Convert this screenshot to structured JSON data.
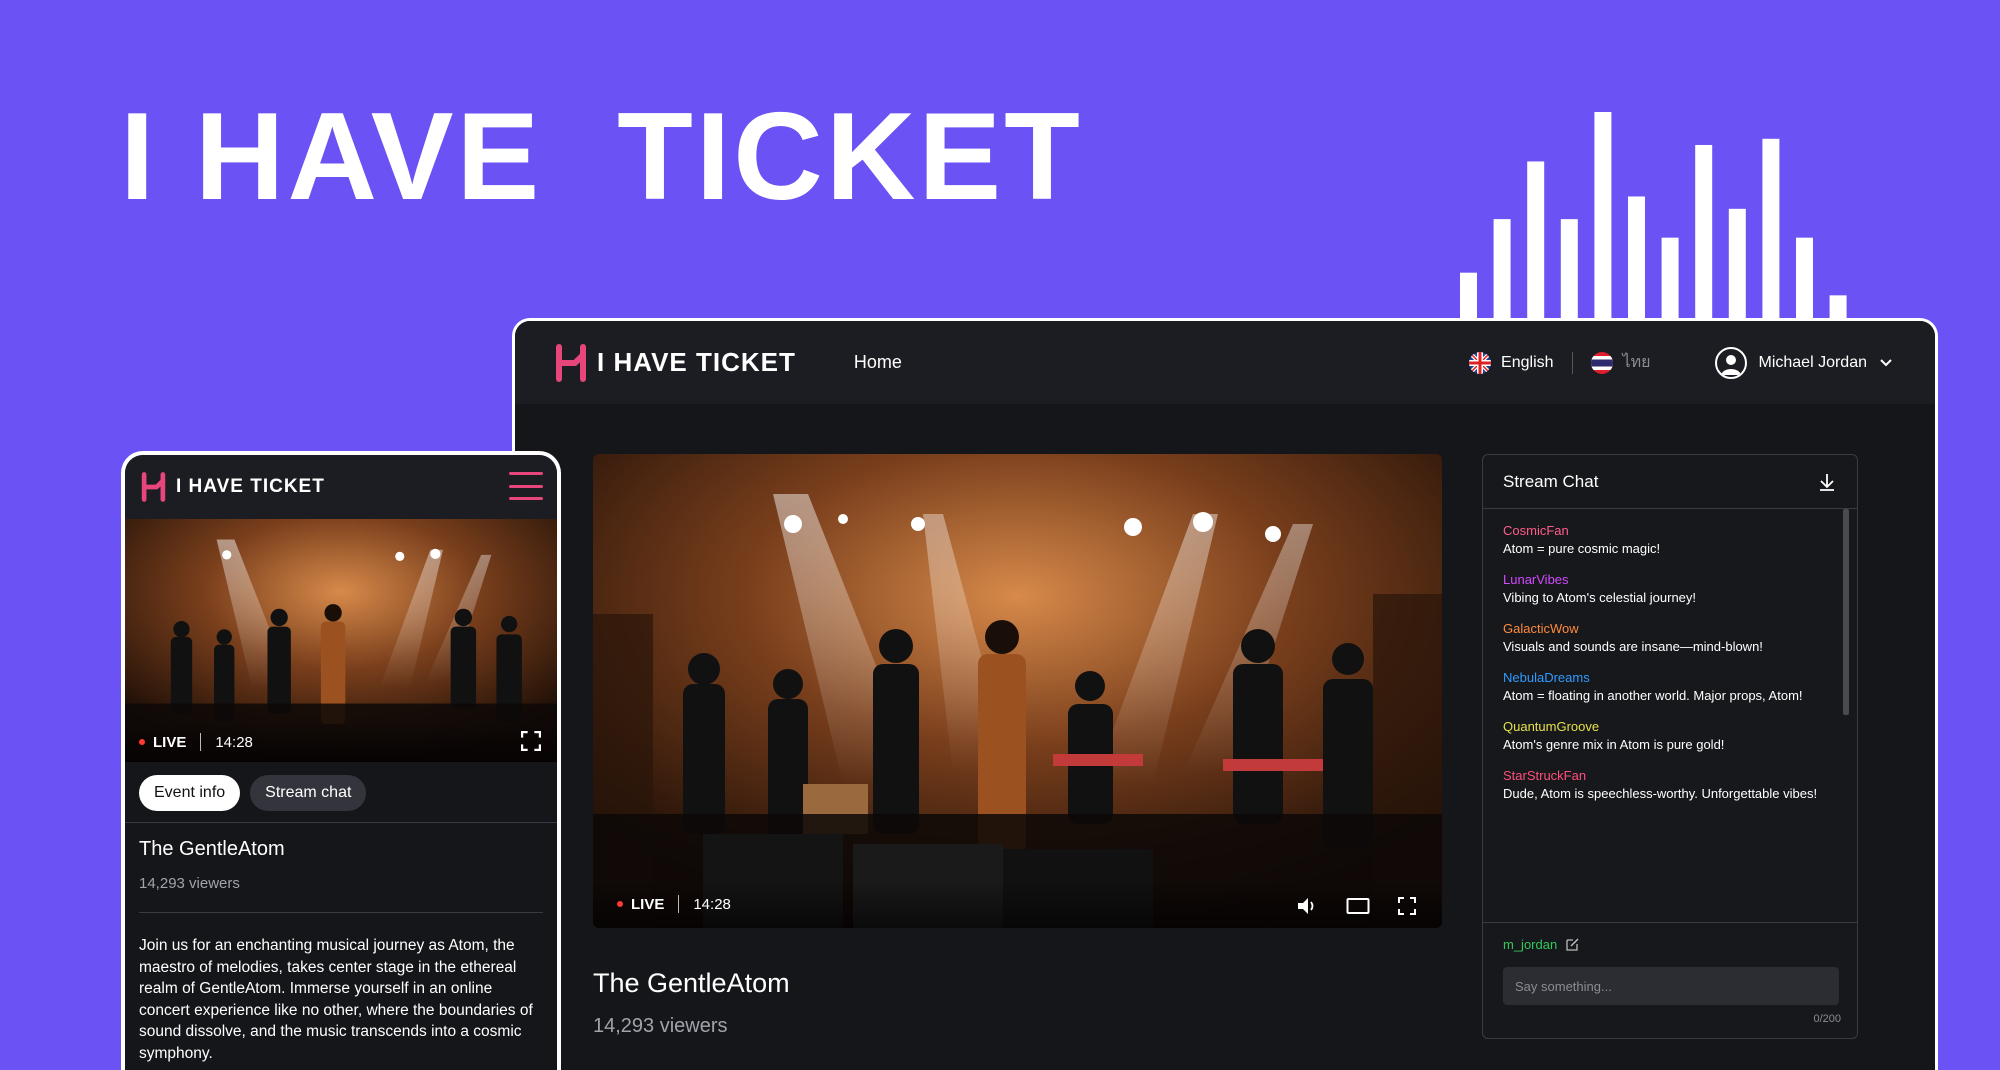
{
  "hero": {
    "title": "I HAVE  TICKET"
  },
  "equalizer": {
    "levels": [
      0.22,
      0.48,
      0.76,
      0.48,
      1.0,
      0.59,
      0.39,
      0.84,
      0.53,
      0.87,
      0.39,
      0.11
    ]
  },
  "brand": {
    "name": "I HAVE TICKET",
    "accent": "#e8457a"
  },
  "desktop": {
    "nav": {
      "home": "Home",
      "lang_en": "English",
      "lang_th": "ไทย",
      "user_name": "Michael Jordan"
    },
    "player": {
      "live": "LIVE",
      "time": "14:28"
    },
    "event": {
      "title": "The GentleAtom",
      "viewers": "14,293 viewers"
    },
    "chat": {
      "title": "Stream Chat",
      "messages": [
        {
          "user": "CosmicFan",
          "color": "#ff5c8a",
          "text": "Atom = pure cosmic magic!"
        },
        {
          "user": "LunarVibes",
          "color": "#d24bff",
          "text": "Vibing to Atom's celestial journey!"
        },
        {
          "user": "GalacticWow",
          "color": "#ff8a3d",
          "text": "Visuals and sounds are insane—mind-blown!"
        },
        {
          "user": "NebulaDreams",
          "color": "#2f9bff",
          "text": "Atom = floating in another world. Major props, Atom!"
        },
        {
          "user": "QuantumGroove",
          "color": "#e7e04b",
          "text": "Atom's genre mix in Atom is pure gold!"
        },
        {
          "user": "StarStruckFan",
          "color": "#ff4f7b",
          "text": "Dude, Atom is speechless-worthy. Unforgettable vibes!"
        }
      ],
      "username": "m_jordan",
      "placeholder": "Say something...",
      "counter": "0/200"
    }
  },
  "mobile": {
    "player": {
      "live": "LIVE",
      "time": "14:28"
    },
    "tabs": {
      "event_info": "Event info",
      "stream_chat": "Stream chat"
    },
    "event": {
      "title": "The GentleAtom",
      "viewers": "14,293 viewers",
      "description": "Join us for an enchanting musical journey as Atom, the maestro of melodies, takes center stage in the ethereal realm of GentleAtom. Immerse yourself in an online concert experience like no other, where the boundaries of sound dissolve, and the music transcends into a cosmic symphony."
    }
  }
}
